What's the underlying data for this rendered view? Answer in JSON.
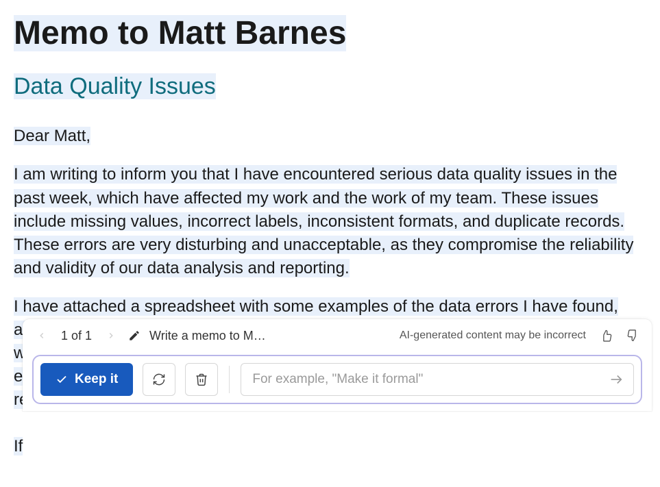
{
  "doc": {
    "title": "Memo to Matt Barnes",
    "subtitle": "Data Quality Issues",
    "salutation": "Dear Matt,",
    "para1": "I am writing to inform you that I have encountered serious data quality issues in the past week, which have affected my work and the work of my team. These issues include missing values, incorrect labels, inconsistent formats, and duplicate records. These errors are very disturbing and unacceptable, as they compromise the reliability and validity of our data analysis and reporting.",
    "para2_a": "I have attached a spreadsheet with some examples of the data errors I have found, along ",
    "para2_b": "w",
    "para2_c": "e",
    "para2_d": "re",
    "para2_e": "If"
  },
  "ai": {
    "counter": "1 of 1",
    "prompt": "Write a memo to M…",
    "disclaimer": "AI-generated content may be incorrect",
    "keep": "Keep it",
    "refine_placeholder": "For example, \"Make it formal\""
  }
}
